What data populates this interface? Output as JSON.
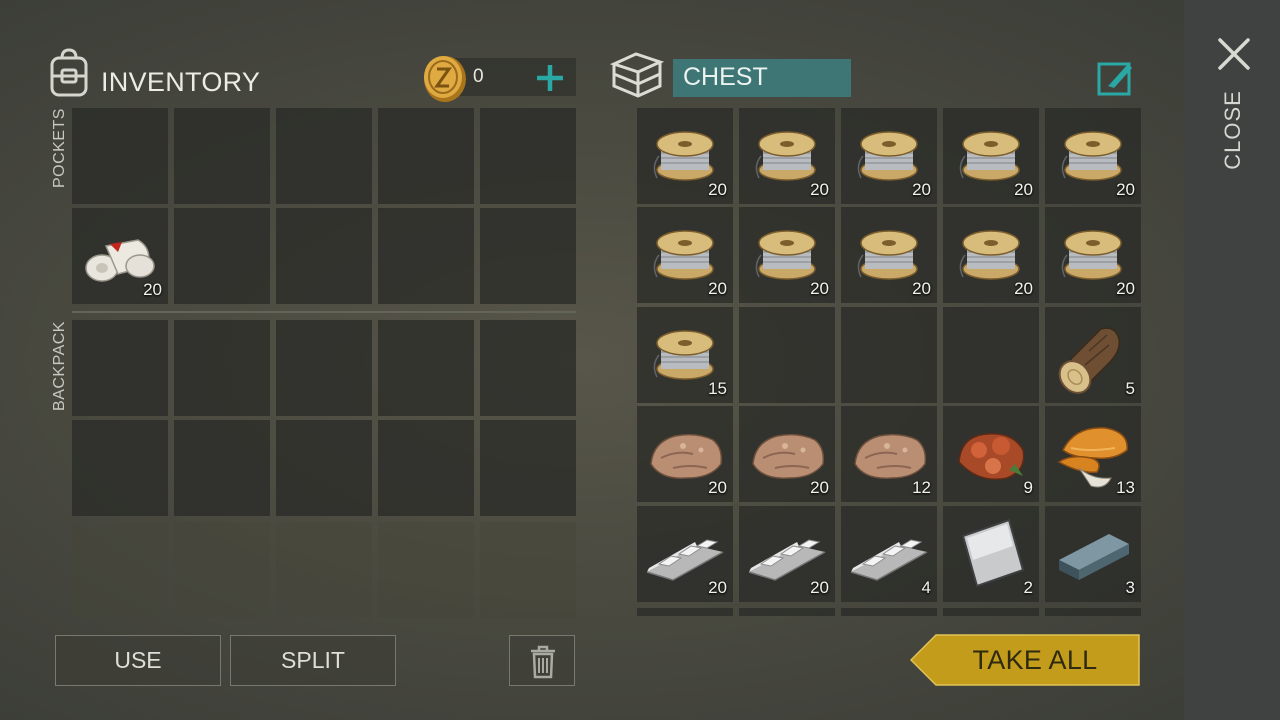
{
  "inventory": {
    "title": "INVENTORY",
    "coins": "0",
    "pockets_label": "POCKETS",
    "backpack_label": "BACKPACK",
    "pockets": [
      {
        "item": "",
        "qty": ""
      },
      {
        "item": "",
        "qty": ""
      },
      {
        "item": "",
        "qty": ""
      },
      {
        "item": "",
        "qty": ""
      },
      {
        "item": "",
        "qty": ""
      },
      {
        "item": "bandage-icon",
        "qty": "20"
      },
      {
        "item": "",
        "qty": ""
      },
      {
        "item": "",
        "qty": ""
      },
      {
        "item": "",
        "qty": ""
      },
      {
        "item": "",
        "qty": ""
      }
    ],
    "backpack_rows": 2,
    "locked_rows": 1
  },
  "chest": {
    "title": "CHEST",
    "items": [
      {
        "item": "wire-spool-icon",
        "qty": "20"
      },
      {
        "item": "wire-spool-icon",
        "qty": "20"
      },
      {
        "item": "wire-spool-icon",
        "qty": "20"
      },
      {
        "item": "wire-spool-icon",
        "qty": "20"
      },
      {
        "item": "wire-spool-icon",
        "qty": "20"
      },
      {
        "item": "wire-spool-icon",
        "qty": "20"
      },
      {
        "item": "wire-spool-icon",
        "qty": "20"
      },
      {
        "item": "wire-spool-icon",
        "qty": "20"
      },
      {
        "item": "wire-spool-icon",
        "qty": "20"
      },
      {
        "item": "wire-spool-icon",
        "qty": "20"
      },
      {
        "item": "wire-spool-icon",
        "qty": "15"
      },
      {
        "item": "",
        "qty": ""
      },
      {
        "item": "",
        "qty": ""
      },
      {
        "item": "",
        "qty": ""
      },
      {
        "item": "log-icon",
        "qty": "5"
      },
      {
        "item": "stone-icon",
        "qty": "20"
      },
      {
        "item": "stone-icon",
        "qty": "20"
      },
      {
        "item": "stone-icon",
        "qty": "12"
      },
      {
        "item": "ore-icon",
        "qty": "9"
      },
      {
        "item": "mushroom-icon",
        "qty": "13"
      },
      {
        "item": "metal-ingot-icon",
        "qty": "20"
      },
      {
        "item": "metal-ingot-icon",
        "qty": "20"
      },
      {
        "item": "metal-ingot-icon",
        "qty": "4"
      },
      {
        "item": "steel-plate-icon",
        "qty": "2"
      },
      {
        "item": "steel-bar-icon",
        "qty": "3"
      }
    ]
  },
  "buttons": {
    "use": "USE",
    "split": "SPLIT",
    "take_all": "TAKE ALL",
    "close": "CLOSE"
  },
  "colors": {
    "accent_teal": "#1f9a98",
    "chest_field": "#3e7676",
    "take_all_fill": "#c49c1c",
    "coin_gold": "#d9a53a"
  }
}
